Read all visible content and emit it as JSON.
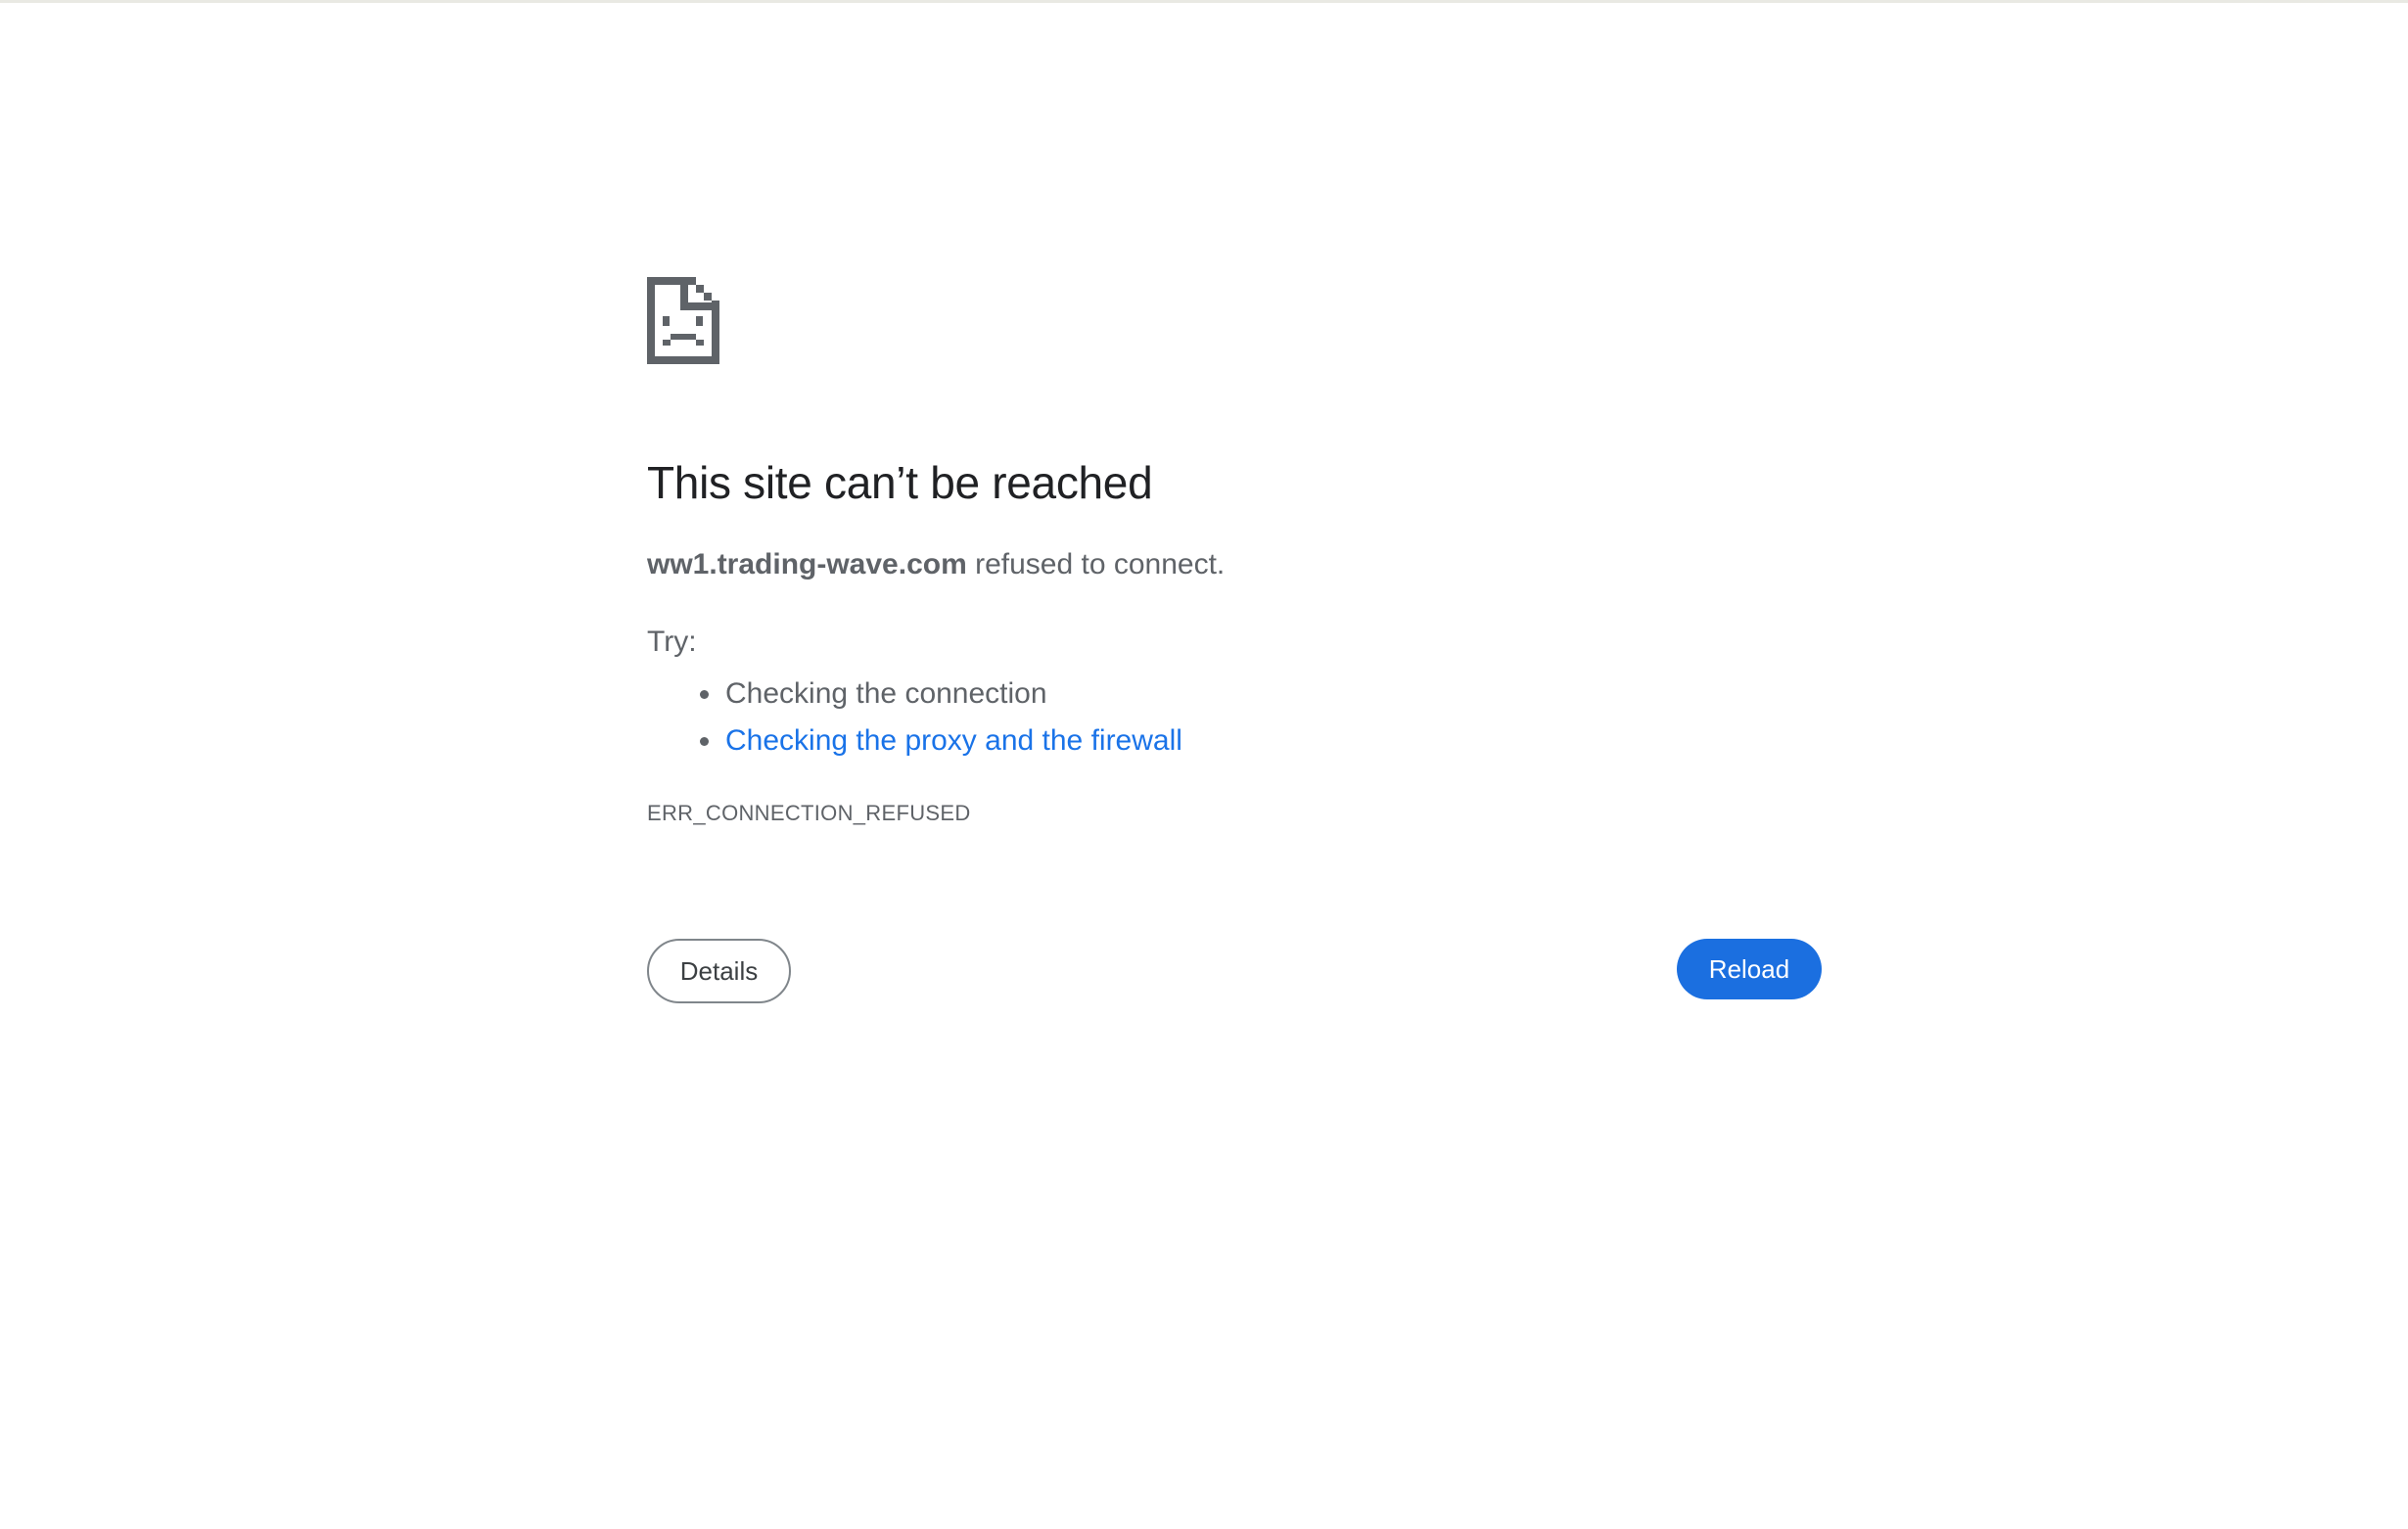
{
  "error": {
    "title": "This site can’t be reached",
    "host": "ww1.trading-wave.com",
    "message_suffix": " refused to connect.",
    "try_label": "Try:",
    "suggestions": [
      {
        "text": "Checking the connection",
        "is_link": false
      },
      {
        "text": "Checking the proxy and the firewall",
        "is_link": true
      }
    ],
    "code": "ERR_CONNECTION_REFUSED"
  },
  "buttons": {
    "details_label": "Details",
    "reload_label": "Reload"
  },
  "icons": {
    "error_icon": "sad-page-icon"
  },
  "colors": {
    "title": "#202124",
    "body_text": "#5f6368",
    "link": "#1a73e8",
    "reload_bg": "#1b6fe0",
    "icon": "#5f6368"
  }
}
